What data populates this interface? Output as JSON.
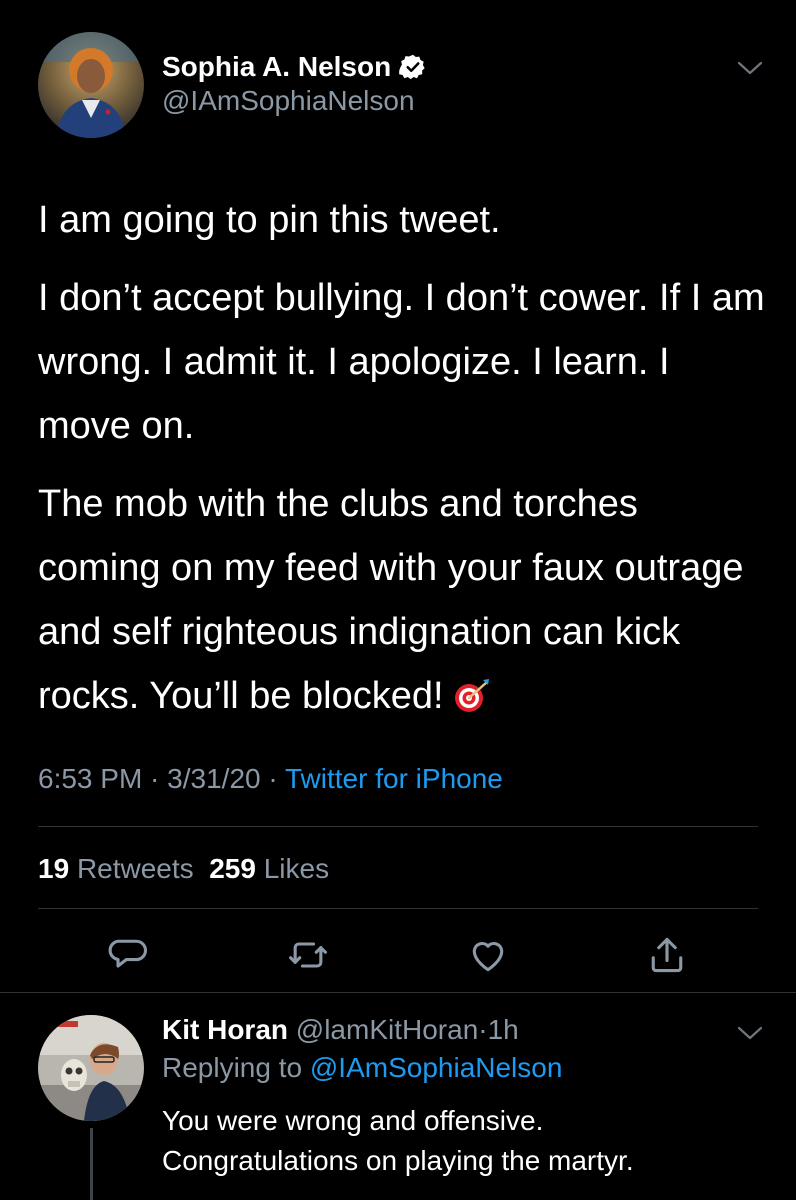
{
  "tweet": {
    "author_name": "Sophia A. Nelson",
    "author_handle": "@IAmSophiaNelson",
    "paragraphs": [
      "I am going to pin this tweet.",
      "I don’t accept bullying. I don’t cower. If I am wrong. I admit it. I apologize. I learn. I move on.",
      "The mob with the clubs and torches coming on my feed with your faux outrage and self righteous indignation can kick rocks. You’ll be blocked!"
    ],
    "emoji": "target-icon",
    "time": "6:53 PM",
    "date": "3/31/20",
    "sep": " · ",
    "source": "Twitter for iPhone",
    "retweets_count": "19",
    "retweets_label": "Retweets",
    "likes_count": "259",
    "likes_label": "Likes"
  },
  "reply": {
    "author_name": "Kit Horan",
    "author_handle": "@lamKitHoran",
    "time": "1h",
    "sep": "·",
    "replying_label": "Replying to",
    "replying_to": "@IAmSophiaNelson",
    "text_lines": [
      "You were wrong and offensive.",
      "Congratulations on playing the martyr."
    ]
  },
  "icons": {
    "verified": "verified-badge-icon",
    "chevron": "chevron-down-icon",
    "reply": "reply-icon",
    "retweet": "retweet-icon",
    "like": "heart-icon",
    "share": "share-icon"
  },
  "colors": {
    "background": "#000000",
    "text": "#ffffff",
    "secondary": "#8b98a5",
    "link": "#1d9bf0",
    "divider": "#2f3336"
  }
}
